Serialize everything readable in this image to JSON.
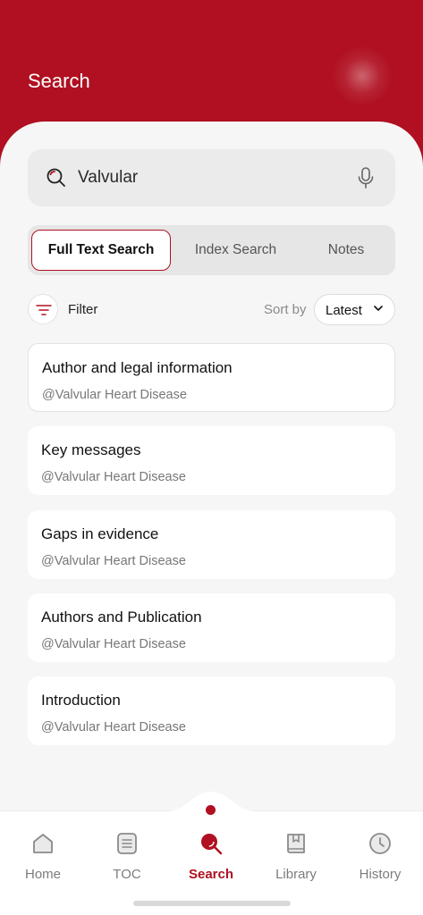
{
  "header": {
    "title": "Search"
  },
  "search": {
    "value": "Valvular",
    "icon": "search-icon",
    "mic_icon": "mic-icon"
  },
  "tabs": [
    {
      "label": "Full Text Search",
      "active": true
    },
    {
      "label": "Index Search",
      "active": false
    },
    {
      "label": "Notes",
      "active": false
    }
  ],
  "toolbar": {
    "filter_label": "Filter",
    "sort_label": "Sort by",
    "sort_value": "Latest"
  },
  "results": [
    {
      "title": "Author and legal information",
      "source": "@Valvular Heart Disease"
    },
    {
      "title": "Key messages",
      "source": "@Valvular Heart Disease"
    },
    {
      "title": "Gaps in evidence",
      "source": "@Valvular Heart Disease"
    },
    {
      "title": "Authors and Publication",
      "source": "@Valvular Heart Disease"
    },
    {
      "title": "Introduction",
      "source": "@Valvular Heart Disease"
    }
  ],
  "nav": [
    {
      "label": "Home",
      "icon": "home-icon",
      "active": false
    },
    {
      "label": "TOC",
      "icon": "toc-icon",
      "active": false
    },
    {
      "label": "Search",
      "icon": "search-icon",
      "active": true
    },
    {
      "label": "Library",
      "icon": "library-icon",
      "active": false
    },
    {
      "label": "History",
      "icon": "history-icon",
      "active": false
    }
  ],
  "colors": {
    "brand": "#b01021",
    "background": "#f6f6f6",
    "card": "#ffffff"
  }
}
